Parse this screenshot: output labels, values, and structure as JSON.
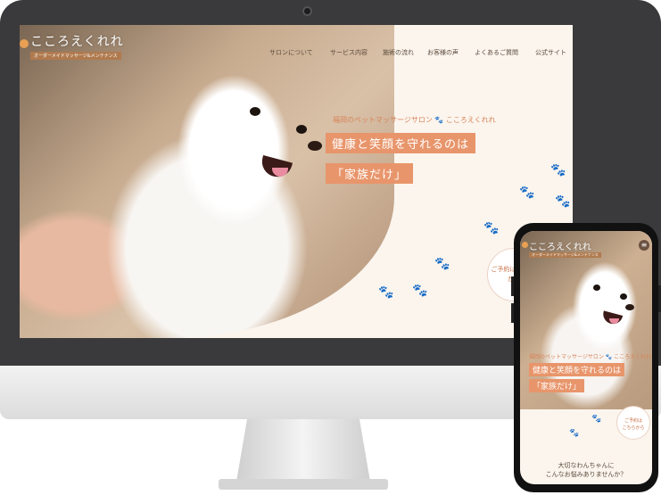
{
  "desktop": {
    "logo": {
      "title": "こころえくれれ",
      "subtitle": "オーダーメイドマッサージ&メンテナンス"
    },
    "nav": [
      "サロンについて",
      "サービス内容",
      "施術の流れ",
      "お客様の声",
      "よくあるご質問",
      "公式サイト"
    ],
    "hero": {
      "tagline": "福岡のペットマッサージサロン 🐾 こころえくれれ",
      "headline_1": "健康と笑顔を守れるのは",
      "headline_2": "「家族だけ」"
    },
    "reserve": "ご予約は こちらから"
  },
  "mobile": {
    "logo": {
      "title": "こころえくれれ",
      "subtitle": "オーダーメイドマッサージ&メンテナンス"
    },
    "menu_icon": "≡",
    "hero": {
      "tagline": "福岡のペットマッサージサロン 🐾 こころえくれれ",
      "headline_1": "健康と笑顔を守れるのは",
      "headline_2": "「家族だけ」"
    },
    "reserve_1": "ご予約は",
    "reserve_2": "こちらから",
    "worry_1": "大切なわんちゃんに",
    "worry_2": "こんなお悩みありませんか？"
  },
  "colors": {
    "accent": "#e8956b",
    "brown": "#5b4a3b",
    "bezel": "#3a3a3c"
  }
}
